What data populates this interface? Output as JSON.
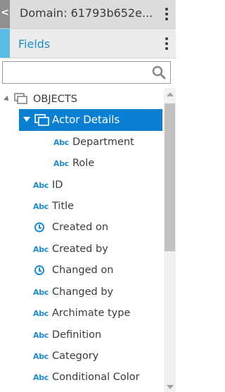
{
  "header": {
    "back_glyph": "<",
    "title": "Domain: 61793b652e..."
  },
  "fields": {
    "label": "Fields"
  },
  "search": {
    "value": "",
    "placeholder": ""
  },
  "tree": {
    "root_label": "OBJECTS",
    "selected_label": "Actor Details",
    "abc_text": "Abc",
    "children": [
      "Department",
      "Role"
    ],
    "items": [
      {
        "label": "ID",
        "icon": "text-icon"
      },
      {
        "label": "Title",
        "icon": "text-icon"
      },
      {
        "label": "Created on",
        "icon": "clock-icon"
      },
      {
        "label": "Created by",
        "icon": "text-icon"
      },
      {
        "label": "Changed on",
        "icon": "clock-icon"
      },
      {
        "label": "Changed by",
        "icon": "text-icon"
      },
      {
        "label": "Archimate type",
        "icon": "text-icon"
      },
      {
        "label": "Definition",
        "icon": "text-icon"
      },
      {
        "label": "Category",
        "icon": "text-icon"
      },
      {
        "label": "Conditional Color",
        "icon": "text-icon"
      }
    ]
  },
  "colors": {
    "accent": "#1b8bc9",
    "selection": "#0b7fd1",
    "fields_accent": "#5bbde4"
  }
}
